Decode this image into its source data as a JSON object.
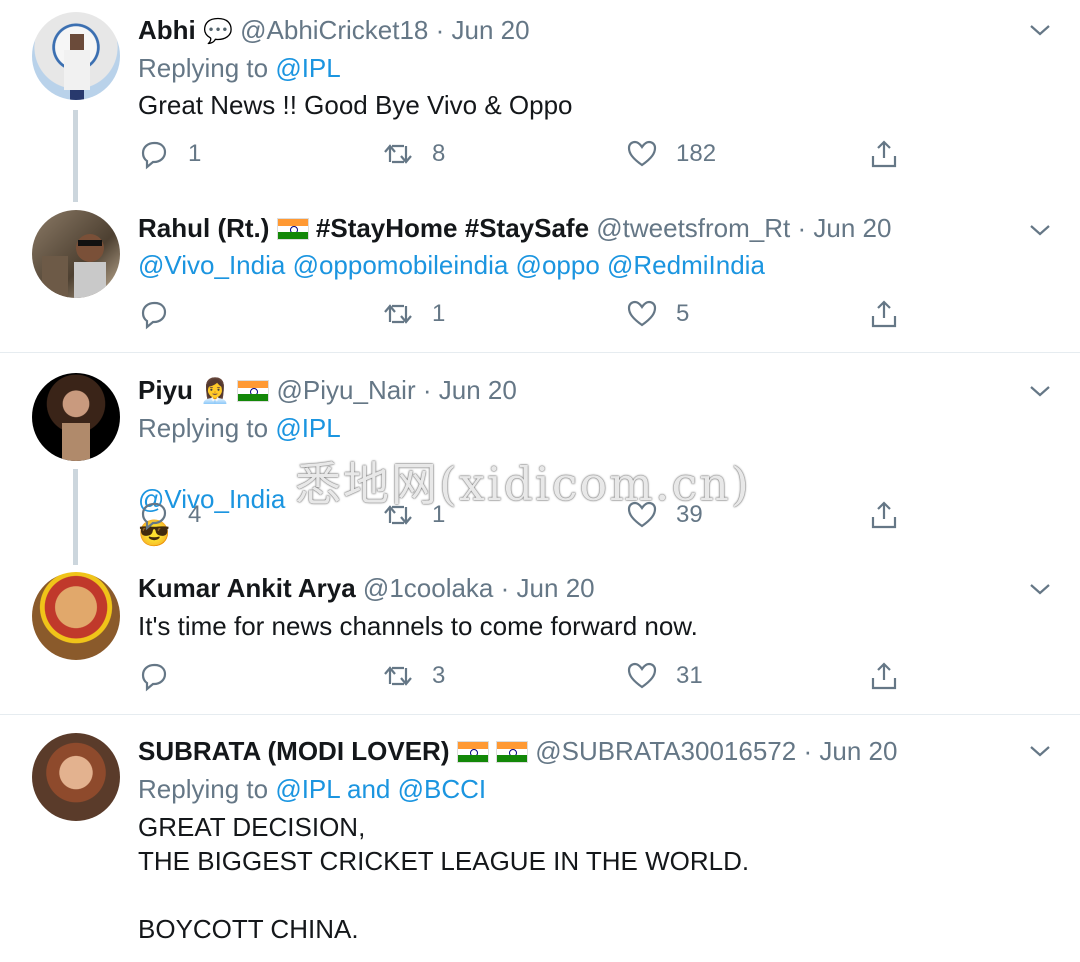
{
  "tweets": [
    {
      "name": "Abhi",
      "name_suffix": "💬",
      "handle": "@AbhiCricket18",
      "date": "Jun 20",
      "replying_label": "Replying to",
      "replying_to": "@IPL",
      "text": "Great News !! Good Bye Vivo & Oppo",
      "replies": "1",
      "retweets": "8",
      "likes": "182"
    },
    {
      "name": "Rahul (Rt.)",
      "name_suffix": "#StayHome #StaySafe",
      "handle": "@tweetsfrom_Rt",
      "date": "Jun 20",
      "text": "@Vivo_India @oppomobileindia @oppo @RedmiIndia",
      "replies": "",
      "retweets": "1",
      "likes": "5"
    },
    {
      "name": "Piyu",
      "name_suffix": "👩‍💼",
      "handle": "@Piyu_Nair",
      "date": "Jun 20",
      "replying_label": "Replying to",
      "replying_to": "@IPL",
      "text": "@Vivo_India",
      "text_emoji": "😎",
      "replies": "4",
      "retweets": "1",
      "likes": "39"
    },
    {
      "name": "Kumar Ankit Arya",
      "handle": "@1coolaka",
      "date": "Jun 20",
      "text": "It's time for news channels to come forward now.",
      "replies": "",
      "retweets": "3",
      "likes": "31"
    },
    {
      "name": "SUBRATA (MODI LOVER)",
      "handle": "@SUBRATA30016572",
      "date": "Jun 20",
      "replying_label": "Replying to",
      "replying_to": "@IPL and @BCCI",
      "text": "GREAT DECISION,\nTHE  BIGGEST CRICKET LEAGUE IN THE WORLD.\n\nBOYCOTT CHINA."
    }
  ],
  "separator": "·",
  "watermark": "悉地网(xidicom.cn)",
  "colors": {
    "link": "#1b95e0",
    "muted": "#657786",
    "text": "#14171a",
    "thread": "#ccd6dd"
  },
  "icons": [
    "reply-icon",
    "retweet-icon",
    "like-icon",
    "share-icon",
    "chevron-down-icon",
    "india-flag-icon"
  ]
}
